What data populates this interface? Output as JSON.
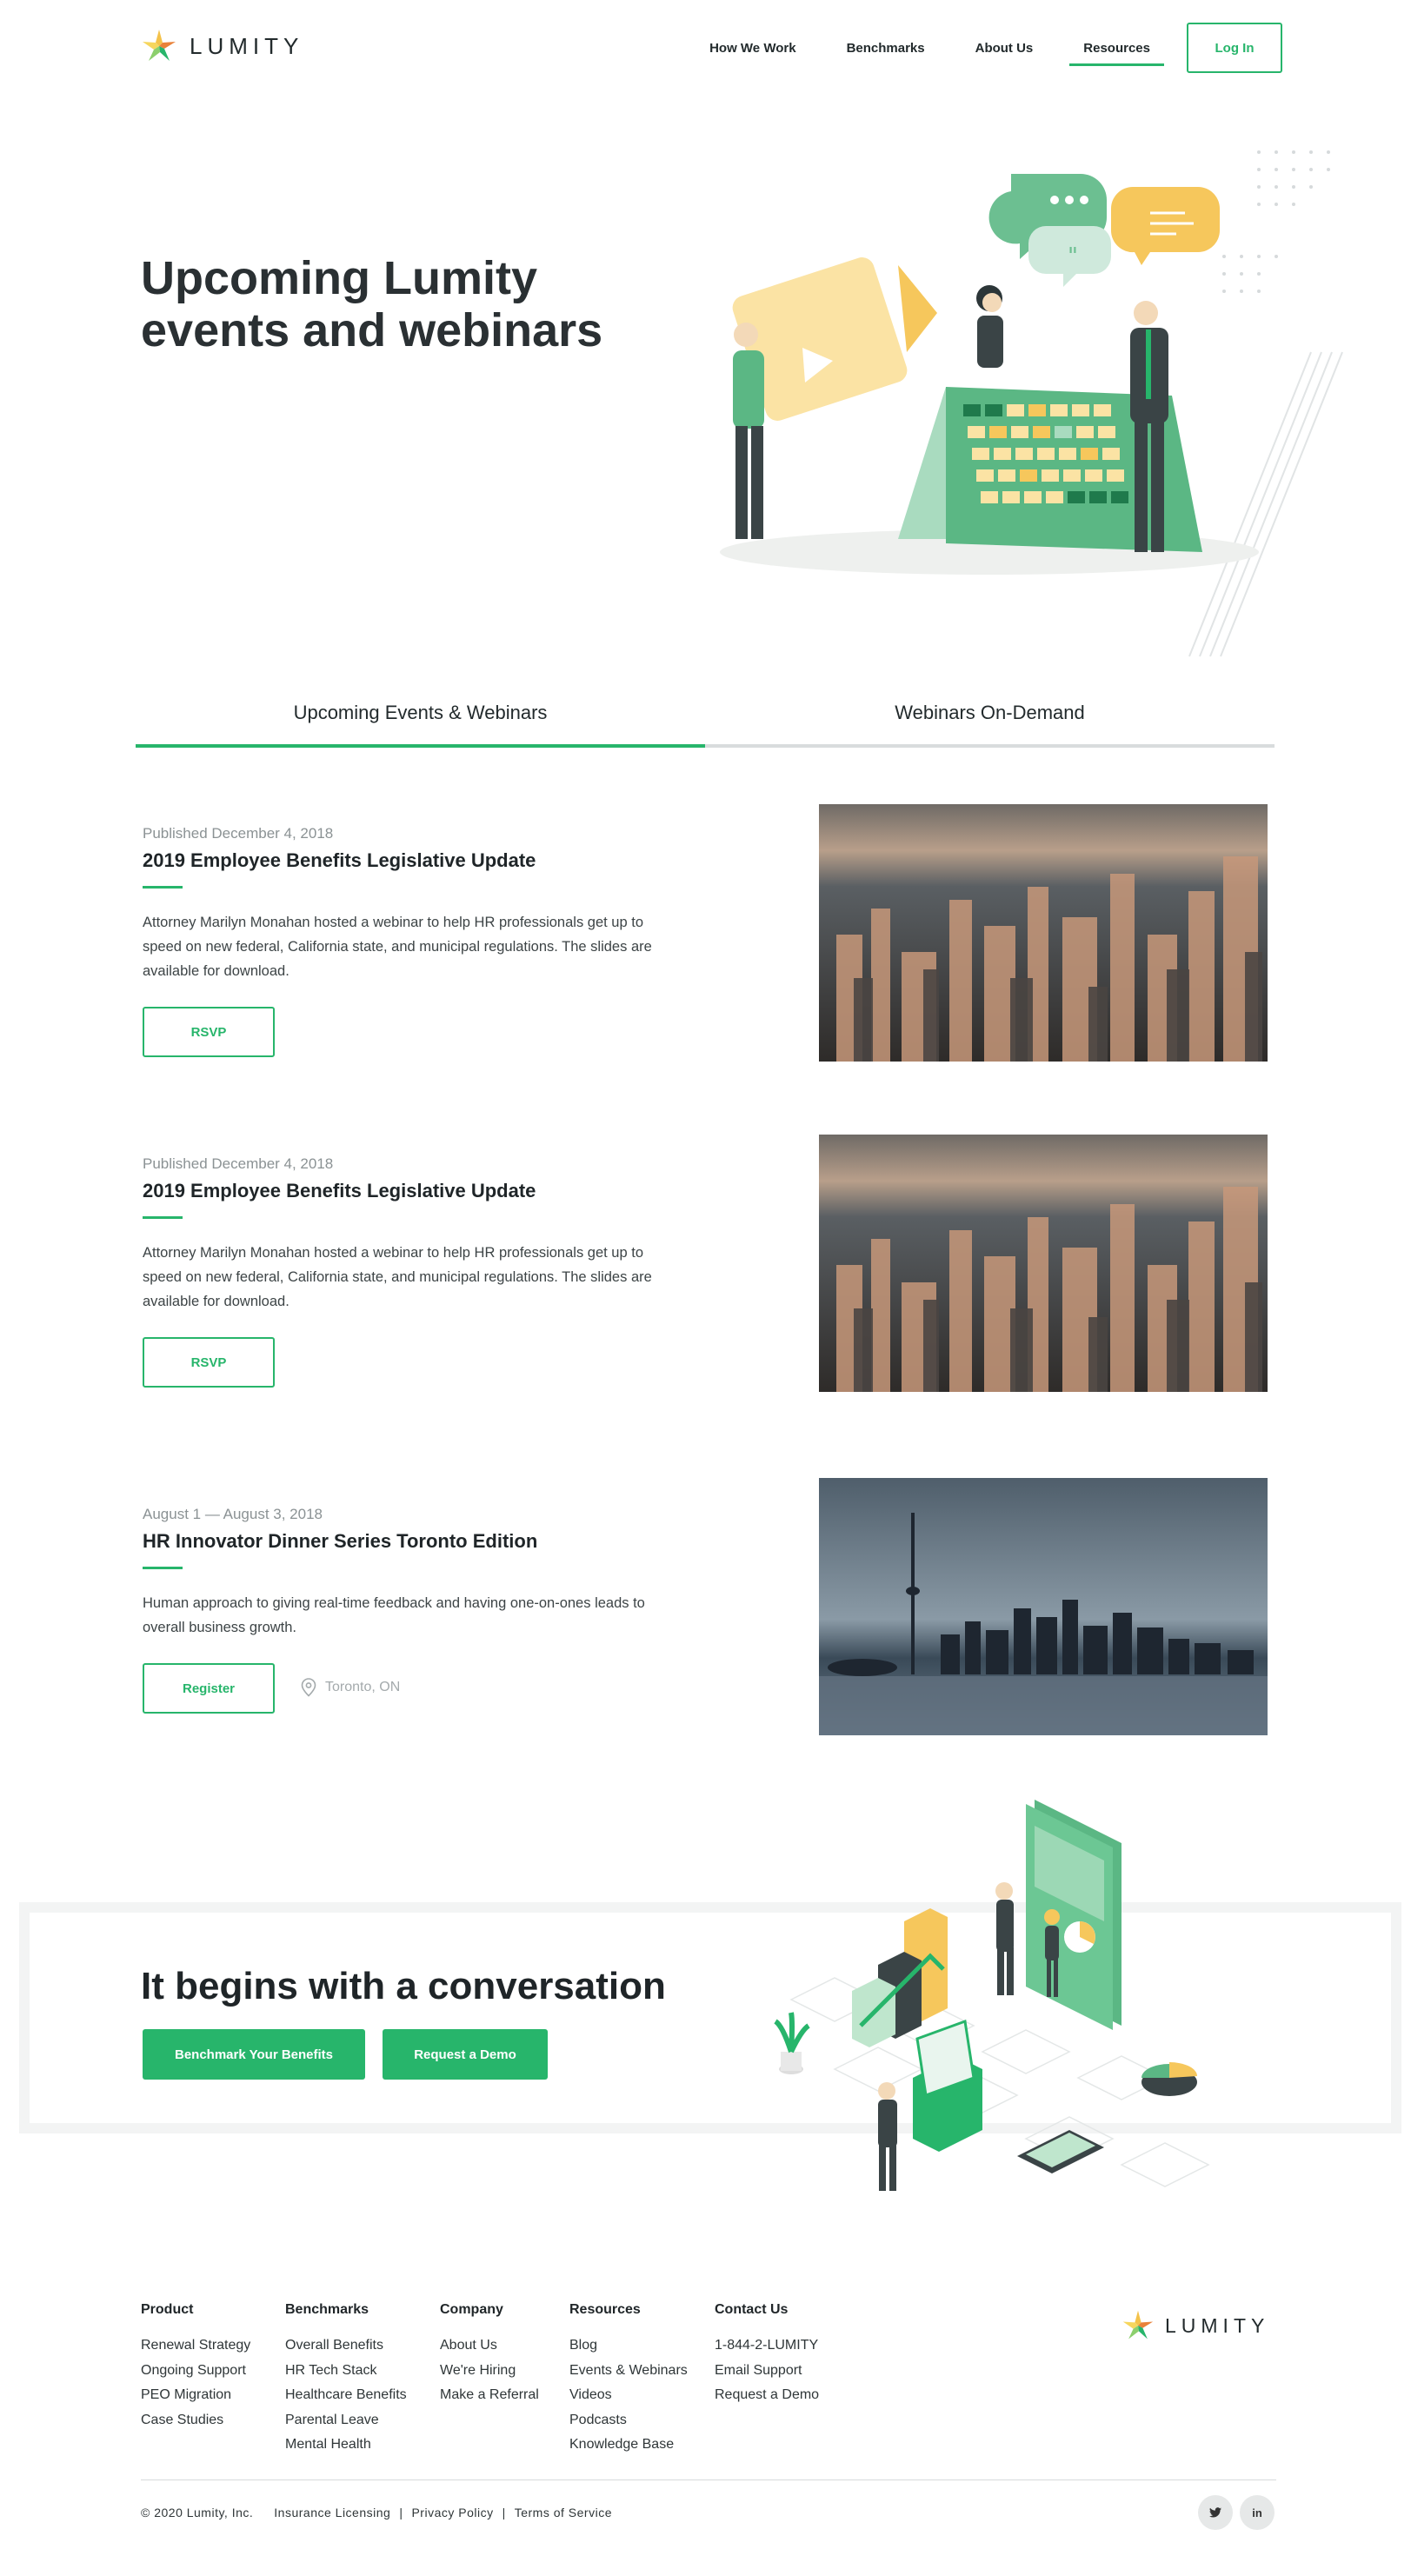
{
  "brand": {
    "name": "LUMITY",
    "accent": "#27b56b",
    "text": "#222a2c"
  },
  "nav": {
    "items": [
      {
        "label": "How We Work"
      },
      {
        "label": "Benchmarks"
      },
      {
        "label": "About Us"
      },
      {
        "label": "Resources",
        "active": true
      }
    ],
    "login_label": "Log In"
  },
  "hero": {
    "title": "Upcoming Lumity events and webinars"
  },
  "tabs": [
    {
      "label": "Upcoming Events & Webinars",
      "active": true
    },
    {
      "label": "Webinars On-Demand",
      "active": false
    }
  ],
  "events": [
    {
      "meta": "Published December 4, 2018",
      "title": "2019 Employee Benefits Legislative Update",
      "description": "Attorney Marilyn Monahan hosted a webinar to help HR professionals get up to speed on new federal, California state, and municipal regulations. The slides are available for download.",
      "button": "RSVP",
      "image": "aerial-city-skyline"
    },
    {
      "meta": "Published December 4, 2018",
      "title": "2019 Employee Benefits Legislative Update",
      "description": "Attorney Marilyn Monahan hosted a webinar to help HR professionals get up to speed on new federal, California state, and municipal regulations. The slides are available for download.",
      "button": "RSVP",
      "image": "aerial-city-skyline"
    },
    {
      "meta": "August 1 — August 3, 2018",
      "title": "HR Innovator Dinner Series Toronto Edition",
      "description": "Human approach to giving real-time feedback and having one-on-ones leads to overall business growth.",
      "button": "Register",
      "location": "Toronto, ON",
      "image": "toronto-skyline"
    }
  ],
  "cta": {
    "title": "It begins with a conversation",
    "primary_label": "Benchmark Your Benefits",
    "secondary_label": "Request a Demo"
  },
  "footer": {
    "columns": [
      {
        "heading": "Product",
        "links": [
          "Renewal Strategy",
          "Ongoing Support",
          "PEO Migration",
          "Case Studies"
        ]
      },
      {
        "heading": "Benchmarks",
        "links": [
          "Overall Benefits",
          "HR Tech Stack",
          "Healthcare Benefits",
          "Parental Leave",
          "Mental Health"
        ]
      },
      {
        "heading": "Company",
        "links": [
          "About Us",
          "We're Hiring",
          "Make a Referral"
        ]
      },
      {
        "heading": "Resources",
        "links": [
          "Blog",
          "Events & Webinars",
          "Videos",
          "Podcasts",
          "Knowledge Base"
        ]
      },
      {
        "heading": "Contact Us",
        "links": [
          "1-844-2-LUMITY",
          "Email Support",
          "Request a Demo"
        ]
      }
    ],
    "copyright": "© 2020 Lumity, Inc.",
    "legal_links": [
      "Insurance Licensing",
      "Privacy Policy",
      "Terms of Service"
    ],
    "social": [
      {
        "icon": "twitter-icon",
        "glyph": "𝕥"
      },
      {
        "icon": "linkedin-icon",
        "glyph": "in"
      }
    ]
  }
}
